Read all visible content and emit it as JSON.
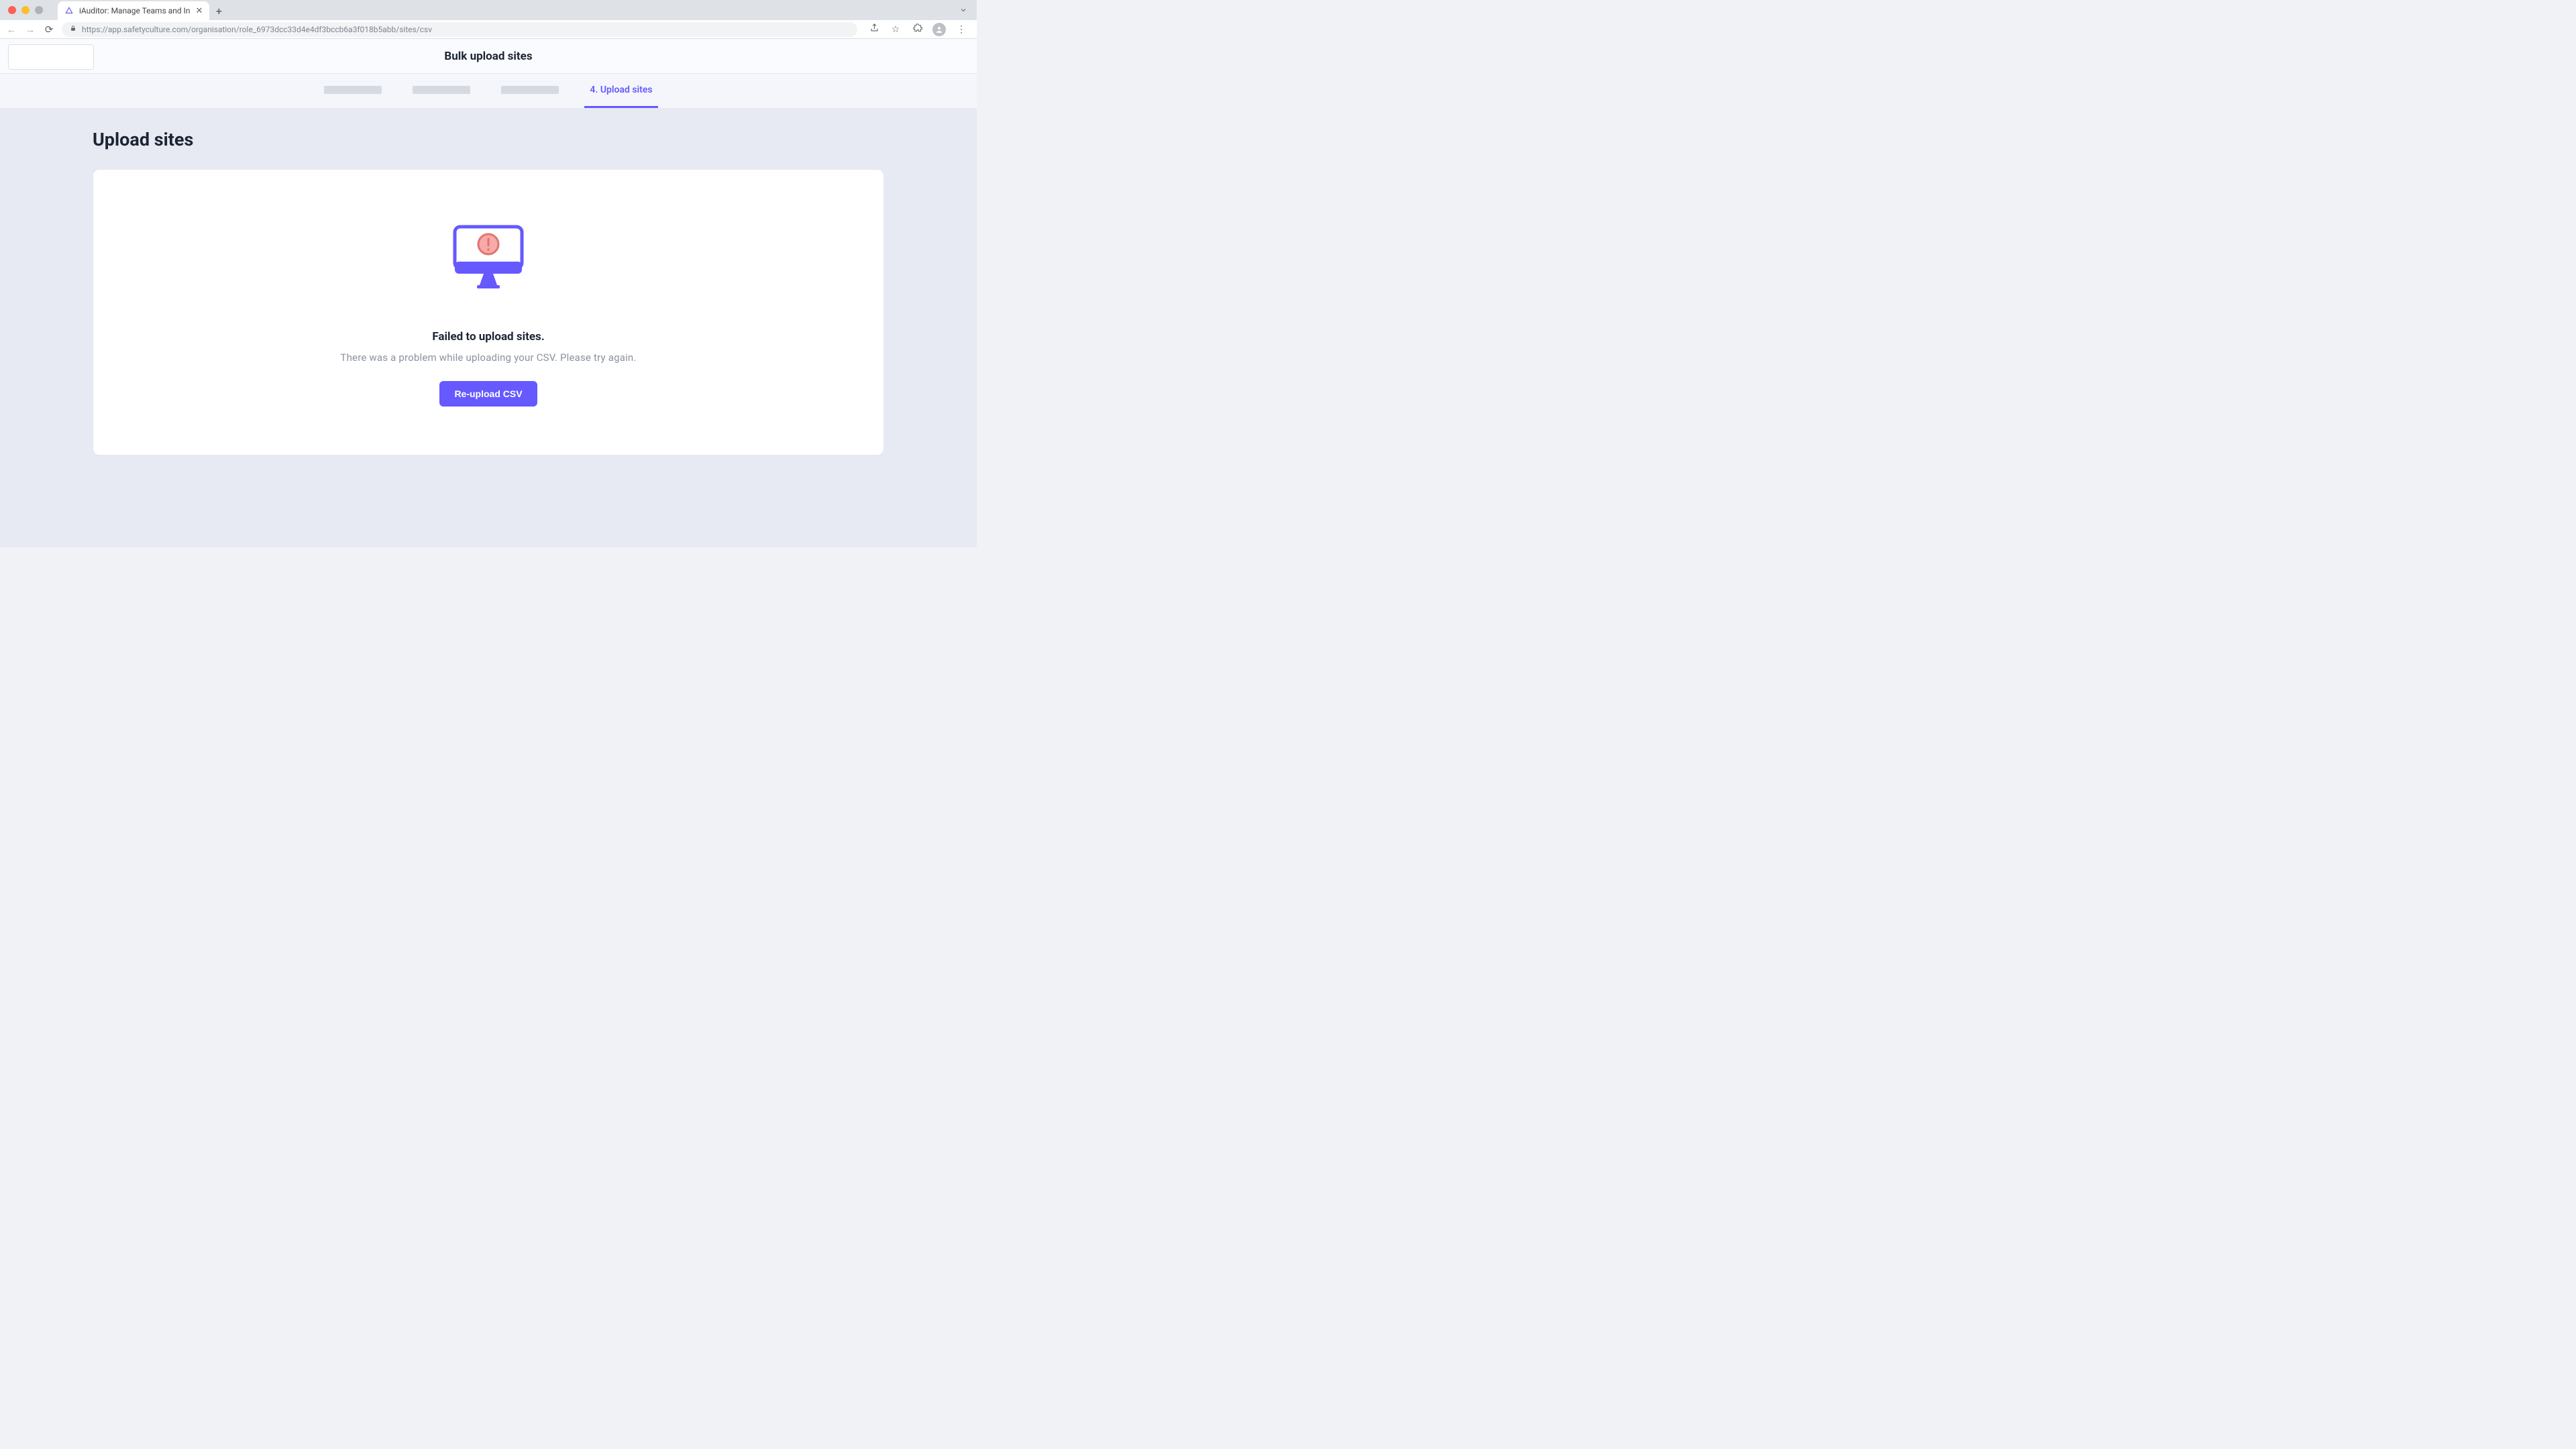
{
  "browser": {
    "tab_title": "iAuditor: Manage Teams and In",
    "url": "https://app.safetyculture.com/organisation/role_6973dcc33d4e4df3bccb6a3f018b5abb/sites/csv"
  },
  "header": {
    "title": "Bulk upload sites"
  },
  "steps": {
    "active_label": "4. Upload sites"
  },
  "main": {
    "section_title": "Upload sites",
    "error_title": "Failed to upload sites.",
    "error_description": "There was a problem while uploading your CSV. Please try again.",
    "reupload_label": "Re-upload CSV"
  },
  "colors": {
    "accent": "#6559ff",
    "error_pink": "#f8a9a8"
  }
}
